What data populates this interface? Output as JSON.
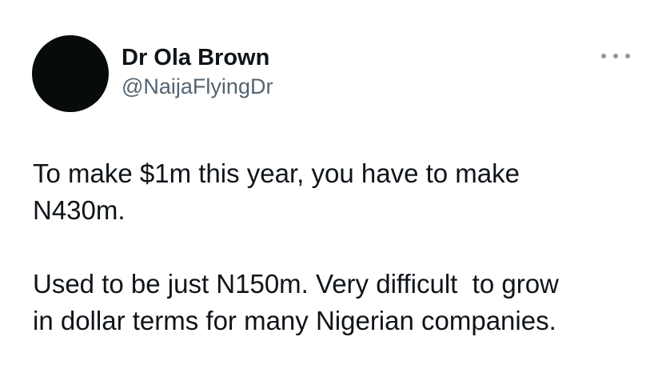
{
  "author": {
    "display_name": "Dr Ola Brown",
    "handle": "@NaijaFlyingDr"
  },
  "menu": {
    "icon": "more-horizontal-icon"
  },
  "tweet": {
    "paragraphs": [
      "To make $1m this year, you have to make\nN430m.",
      "Used to be just N150m. Very difficult  to grow\nin dollar terms for many Nigerian companies."
    ]
  }
}
